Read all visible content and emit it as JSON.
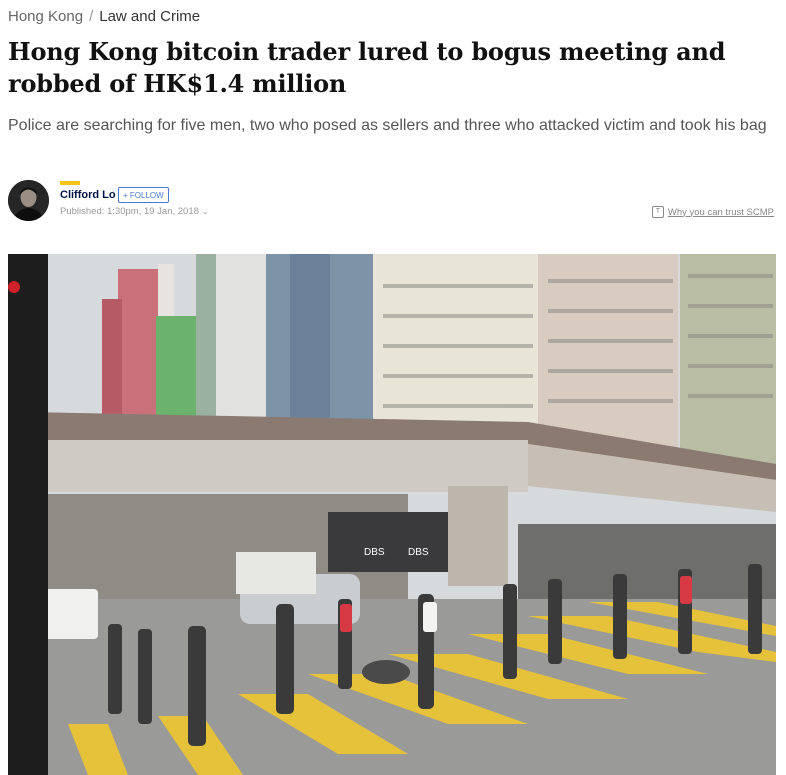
{
  "breadcrumb": {
    "section": "Hong Kong",
    "separator": "/",
    "subsection": "Law and Crime"
  },
  "article": {
    "headline": "Hong Kong bitcoin trader lured to bogus meeting and robbed of HK$1.4 million",
    "subheadline": "Police are searching for five men, two who posed as sellers and three who attacked victim and took his bag"
  },
  "author": {
    "name": "Clifford Lo",
    "follow_label": "+ FOLLOW",
    "published": "Published: 1:30pm, 19 Jan, 2018",
    "accent_color": "#f7c417"
  },
  "trust": {
    "label": "Why you can trust SCMP",
    "icon": "trust-icon"
  },
  "hero": {
    "signs": [
      "DBS",
      "DBS"
    ]
  }
}
